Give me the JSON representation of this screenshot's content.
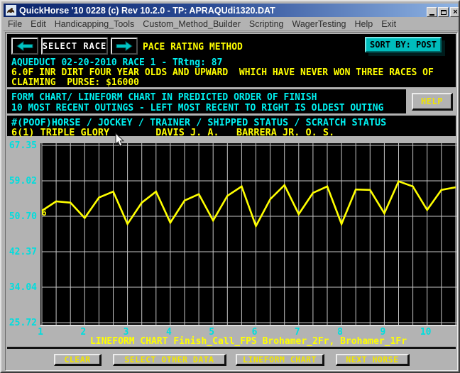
{
  "window": {
    "title": "QuickHorse '10 0228 (c) Rev 10.2.0 - TP: APRAQUdi1320.DAT"
  },
  "menubar": {
    "items": [
      "File",
      "Edit",
      "Handicapping_Tools",
      "Custom_Method_Builder",
      "Scripting",
      "WagerTesting",
      "Help",
      "Exit"
    ]
  },
  "toolbar": {
    "select_race": "SELECT RACE",
    "pace_method": "PACE RATING METHOD",
    "sort_by": "SORT BY: POST"
  },
  "race_info": {
    "line1": "AQUEDUCT 02-20-2010 RACE 1 - TRtng: 87",
    "line2": "6.0F INR DIRT FOUR YEAR OLDS AND UPWARD  WHICH HAVE NEVER WON THREE RACES OF",
    "line3": "CLAIMING  PURSE: $16000"
  },
  "header": {
    "line1": "FORM CHART/ LINEFORM CHART IN PREDICTED ORDER OF FINISH",
    "line2": "10 MOST RECENT OUTINGS - LEFT MOST RECENT TO RIGHT IS OLDEST OUTING",
    "help_label": "HELP"
  },
  "horse_info": {
    "columns": "#(POOF)HORSE / JOCKEY / TRAINER / SHIPPED STATUS / SCRATCH STATUS",
    "row": "6(1) TRIPLE GLORY        DAVIS J. A.   BARRERA JR. O. S."
  },
  "chart_data": {
    "type": "line",
    "caption": "LINEFORM CHART Finish_Call_FPS Brohamer_2Fr, Brohamer_1Fr",
    "metrics_per_outing": [
      "Finish_Call_FPS",
      "Brohamer_2Fr",
      "Brohamer_1Fr"
    ],
    "points_per_x_label": 3,
    "x_tick_labels": [
      "1",
      "2",
      "3",
      "4",
      "5",
      "6",
      "7",
      "8",
      "9",
      "10"
    ],
    "y_tick_labels": [
      "67.35",
      "59.02",
      "50.70",
      "42.37",
      "34.04",
      "25.72"
    ],
    "y_ticks": [
      67.35,
      59.02,
      50.7,
      42.37,
      34.04,
      25.72
    ],
    "ylim": [
      25.72,
      67.35
    ],
    "values": [
      52.0,
      54.2,
      53.9,
      50.3,
      55.1,
      56.5,
      48.9,
      53.9,
      56.5,
      49.2,
      54.4,
      55.9,
      49.7,
      55.5,
      57.7,
      48.4,
      54.7,
      58.0,
      51.2,
      56.2,
      57.7,
      48.9,
      57.0,
      56.9,
      51.4,
      58.9,
      57.7,
      52.2,
      56.9,
      57.5
    ],
    "start_marker_label": "6",
    "line_color": "#ffff00",
    "grid_color": "#c6c6c6",
    "plot_bg": "#000000",
    "grid": "on",
    "legend_position": "bottom-caption"
  },
  "footer": {
    "buttons": [
      "CLEAR",
      "SELECT OTHER DATA",
      "LINEFORM CHART",
      "NEXT HORSE"
    ]
  },
  "colors": {
    "accent_teal": "#00bcbc",
    "text_cyan": "#00f0f0",
    "text_yellow": "#ffff00",
    "window_gray": "#b3b3b3",
    "titlebar_blue": "#0a246a"
  }
}
